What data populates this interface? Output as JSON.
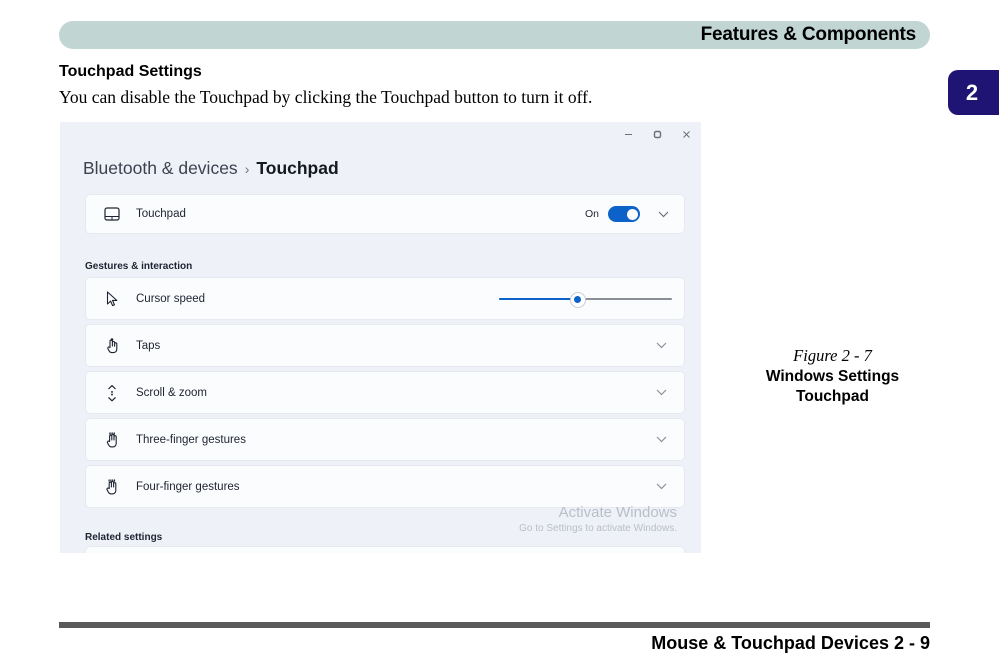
{
  "page": {
    "header_title": "Features & Components",
    "chapter_number": "2",
    "section_heading": "Touchpad Settings",
    "intro_text": "You can disable the Touchpad by clicking the Touchpad button to turn it off.",
    "footer_text": "Mouse & Touchpad Devices  2  -  9"
  },
  "figure": {
    "number": "Figure 2 - 7",
    "line1": "Windows Settings",
    "line2": "Touchpad"
  },
  "settings_window": {
    "window_controls": {
      "minimize": "minimize-icon",
      "restore": "restore-icon",
      "close": "close-icon"
    },
    "breadcrumb": {
      "parent": "Bluetooth & devices",
      "separator": "›",
      "current": "Touchpad"
    },
    "touchpad_card": {
      "icon": "touchpad-icon",
      "label": "Touchpad",
      "toggle_state": "On",
      "expand_icon": "chevron-down-icon"
    },
    "group_label": "Gestures & interaction",
    "rows": [
      {
        "icon": "cursor-arrow-icon",
        "label": "Cursor speed",
        "control": "slider",
        "slider_value": 45
      },
      {
        "icon": "tap-hand-icon",
        "label": "Taps",
        "control": "chevron",
        "expand_icon": "chevron-down-icon"
      },
      {
        "icon": "scroll-zoom-icon",
        "label": "Scroll & zoom",
        "control": "chevron",
        "expand_icon": "chevron-down-icon"
      },
      {
        "icon": "three-finger-hand-icon",
        "label": "Three-finger gestures",
        "control": "chevron",
        "expand_icon": "chevron-down-icon"
      },
      {
        "icon": "four-finger-hand-icon",
        "label": "Four-finger gestures",
        "control": "chevron",
        "expand_icon": "chevron-down-icon"
      }
    ],
    "related_settings_label": "Related settings",
    "watermark": {
      "title": "Activate Windows",
      "subtitle": "Go to Settings to activate Windows."
    }
  },
  "colors": {
    "header_bar": "#c1d5d3",
    "chapter_tab": "#1f1473",
    "accent_blue": "#0d62c9",
    "window_bg": "#eef1f7",
    "card_bg": "#fbfcfe",
    "footer_rule": "#595959"
  }
}
